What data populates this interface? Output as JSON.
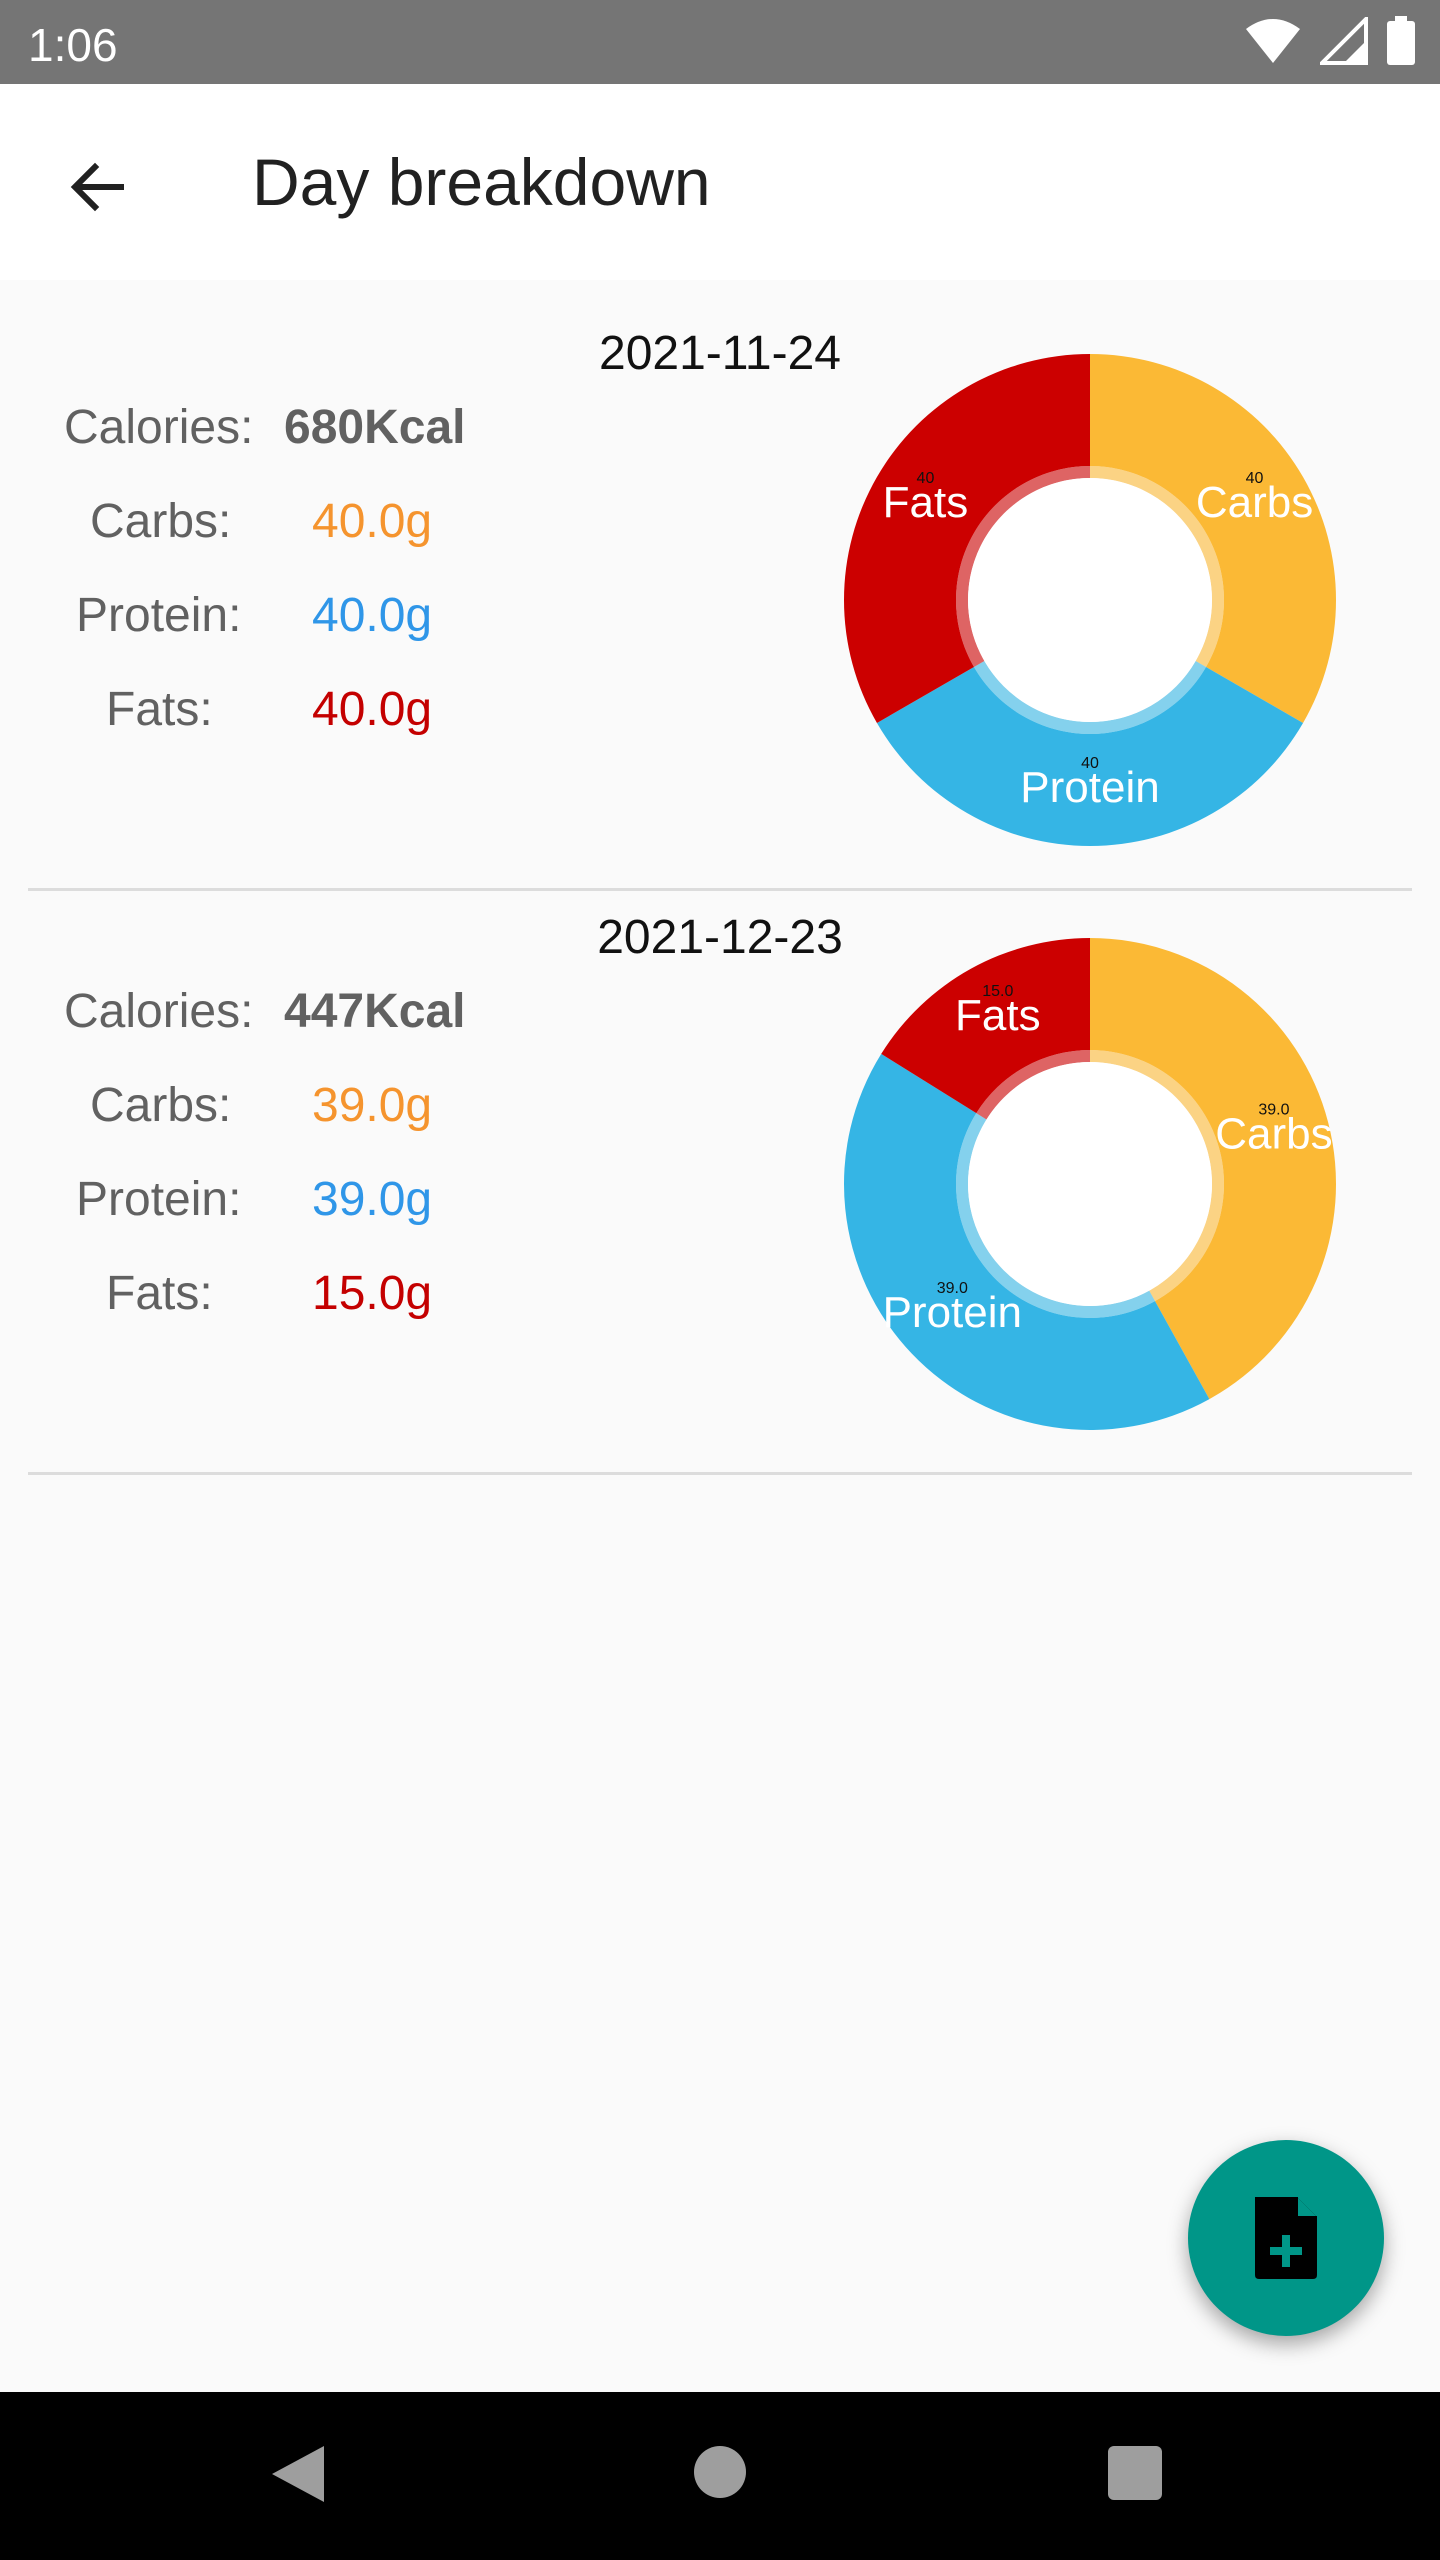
{
  "status_bar": {
    "time": "1:06"
  },
  "app_bar": {
    "title": "Day breakdown"
  },
  "colors": {
    "carbs": "#f5942e",
    "protein": "#2f96e8",
    "fats": "#c40000",
    "fab": "#009688"
  },
  "days": [
    {
      "date": "2021-11-24",
      "calories_label": "Calories:",
      "calories_value": "680Kcal",
      "carbs_label": "Carbs:",
      "carbs_value": "40.0g",
      "protein_label": "Protein:",
      "protein_value": "40.0g",
      "fats_label": "Fats:",
      "fats_value": "40.0g",
      "chart_data": {
        "type": "pie",
        "slices": [
          {
            "name": "Carbs",
            "value": 40,
            "value_label": "40",
            "color": "#fbb935"
          },
          {
            "name": "Protein",
            "value": 40,
            "value_label": "40",
            "color": "#35b5e5"
          },
          {
            "name": "Fats",
            "value": 40,
            "value_label": "40",
            "color": "#cc0000"
          }
        ]
      }
    },
    {
      "date": "2021-12-23",
      "calories_label": "Calories:",
      "calories_value": "447Kcal",
      "carbs_label": "Carbs:",
      "carbs_value": "39.0g",
      "protein_label": "Protein:",
      "protein_value": "39.0g",
      "fats_label": "Fats:",
      "fats_value": "15.0g",
      "chart_data": {
        "type": "pie",
        "slices": [
          {
            "name": "Carbs",
            "value": 39,
            "value_label": "39.0",
            "color": "#fbb935"
          },
          {
            "name": "Protein",
            "value": 39,
            "value_label": "39.0",
            "color": "#35b5e5"
          },
          {
            "name": "Fats",
            "value": 15,
            "value_label": "15.0",
            "color": "#cc0000"
          }
        ]
      }
    }
  ],
  "fab": {
    "icon": "add-document-icon"
  },
  "nav_bar": {
    "back_icon": "nav-back-icon",
    "home_icon": "nav-home-icon",
    "recent_icon": "nav-recent-icon"
  }
}
